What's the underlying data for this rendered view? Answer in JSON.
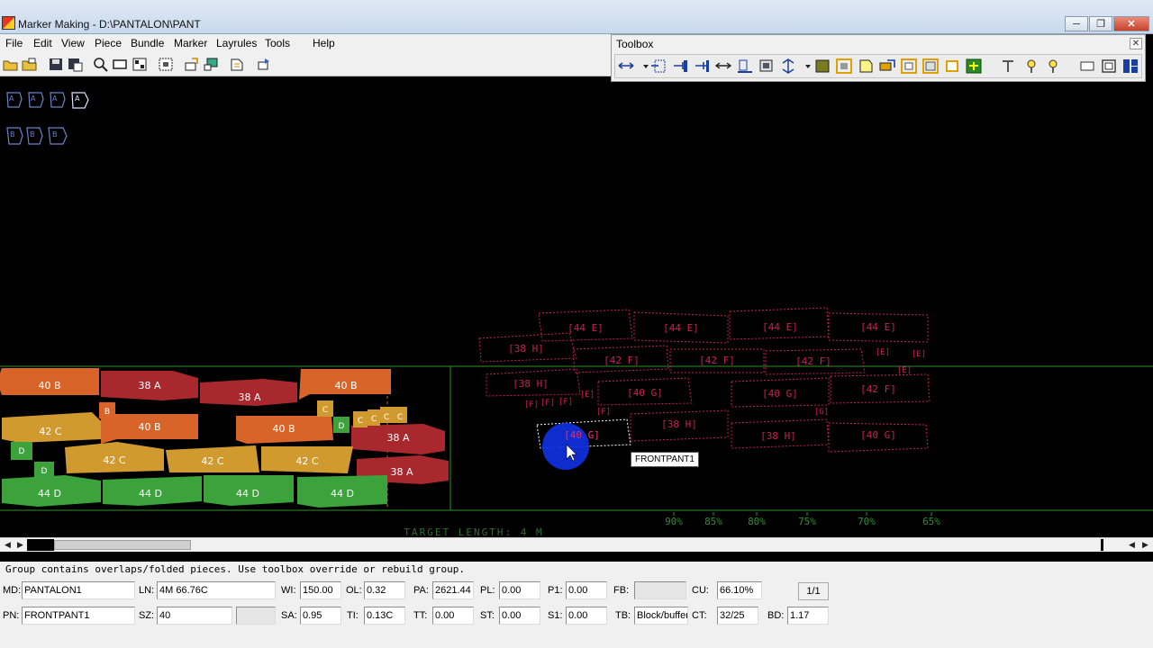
{
  "window": {
    "title": "Marker Making - D:\\PANTALON\\PANT",
    "minimize": "─",
    "maximize": "❐",
    "close": "✕"
  },
  "menu": [
    "File",
    "Edit",
    "View",
    "Piece",
    "Bundle",
    "Marker",
    "Layrules",
    "Tools",
    "Help"
  ],
  "toolbox": {
    "title": "Toolbox",
    "close": "✕"
  },
  "canvas": {
    "target_length": "TARGET LENGTH:  4 M",
    "percent_marks": [
      "90%",
      "85%",
      "80%",
      "75%",
      "70%",
      "65%"
    ],
    "placed_pieces": [
      {
        "label": "40 B",
        "color": "#d9642a"
      },
      {
        "label": "38 A",
        "color": "#a8282e"
      },
      {
        "label": "38 A",
        "color": "#a8282e"
      },
      {
        "label": "40 B",
        "color": "#d9642a"
      },
      {
        "label": "42 C",
        "color": "#d19a2e"
      },
      {
        "label": "40 B",
        "color": "#d9642a"
      },
      {
        "label": "40 B",
        "color": "#d9642a"
      },
      {
        "label": "38 A",
        "color": "#a8282e"
      },
      {
        "label": "42 C",
        "color": "#d19a2e"
      },
      {
        "label": "42 C",
        "color": "#d19a2e"
      },
      {
        "label": "42 C",
        "color": "#d19a2e"
      },
      {
        "label": "38 A",
        "color": "#a8282e"
      },
      {
        "label": "44 D",
        "color": "#3ca23c"
      },
      {
        "label": "44 D",
        "color": "#3ca23c"
      },
      {
        "label": "44 D",
        "color": "#3ca23c"
      },
      {
        "label": "44 D",
        "color": "#3ca23c"
      }
    ],
    "small_labels": [
      "B",
      "C",
      "D",
      "D",
      "D",
      "C",
      "C",
      "C",
      "C"
    ],
    "outline_pieces": [
      "[44 E]",
      "[44 E]",
      "[44 E]",
      "[44 E]",
      "[38 H]",
      "[42 F]",
      "[42 F]",
      "[42 F]",
      "[38 H]",
      "[40 G]",
      "[40 G]",
      "[42 F]",
      "[38 H]",
      "[38 H]",
      "[40 G]",
      "[40 G]"
    ],
    "outline_small": [
      "[E]",
      "[E]",
      "[E]",
      "[E]",
      "[F]",
      "[F]",
      "[F]",
      "[F]",
      "[G]"
    ],
    "palette_row1": [
      "A",
      "A",
      "A",
      "A"
    ],
    "palette_row2": [
      "B",
      "B",
      "B"
    ],
    "tooltip": "FRONTPANT1",
    "colors": {
      "outline": "#c8205a",
      "grid": "#2f8f2f",
      "target": "#2f6f2f"
    }
  },
  "message": "Group contains overlaps/folded pieces. Use toolbox override or rebuild group.",
  "status": {
    "md_label": "MD:",
    "md": "PANTALON1",
    "ln_label": "LN:",
    "ln": "4M 66.76C",
    "wi_label": "WI:",
    "wi": "150.00",
    "ol_label": "OL:",
    "ol": "0.32",
    "pa_label": "PA:",
    "pa": "2621.44",
    "pl_label": "PL:",
    "pl": "0.00",
    "p1_label": "P1:",
    "p1": "0.00",
    "fb_label": "FB:",
    "fb": "",
    "cu_label": "CU:",
    "cu": "66.10%",
    "page": "1/1",
    "pn_label": "PN:",
    "pn": "FRONTPANT1",
    "sz_label": "SZ:",
    "sz": "40",
    "sa_label": "SA:",
    "sa": "0.95",
    "ti_label": "TI:",
    "ti": "0.13C",
    "tt_label": "TT:",
    "tt": "0.00",
    "st_label": "ST:",
    "st": "0.00",
    "s1_label": "S1:",
    "s1": "0.00",
    "tb_label": "TB:",
    "tb": "Block/buffer",
    "ct_label": "CT:",
    "ct": "32/25",
    "bd_label": "BD:",
    "bd": "1.17"
  }
}
